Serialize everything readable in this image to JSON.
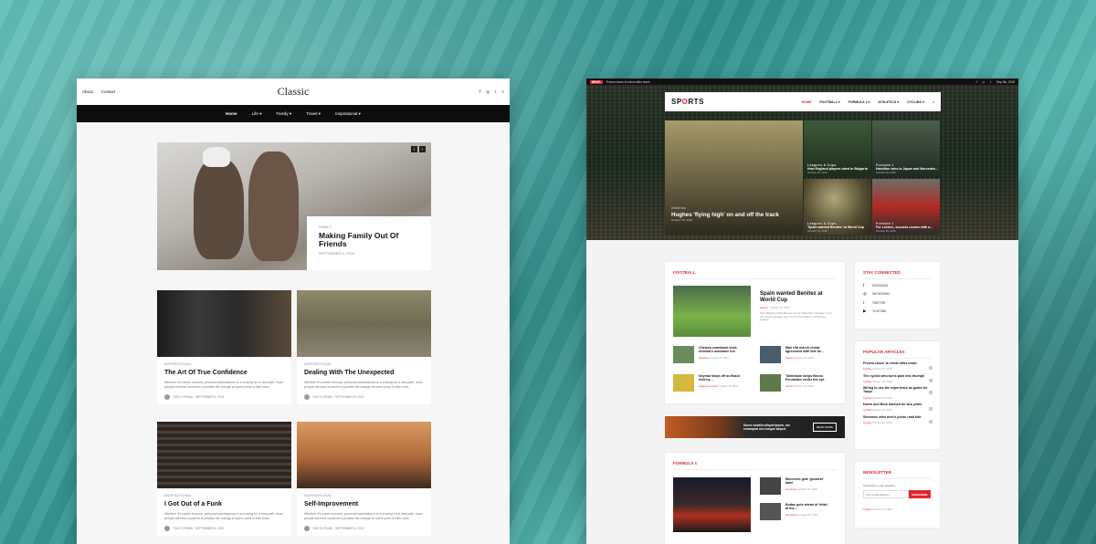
{
  "classic": {
    "top_links": [
      "About",
      "Contact"
    ],
    "logo": "Classic",
    "social": [
      "f",
      "◎",
      "t",
      "⌕"
    ],
    "nav": [
      {
        "label": "Home",
        "active": true
      },
      {
        "label": "Life ▾"
      },
      {
        "label": "Family ▾"
      },
      {
        "label": "Travel ▾"
      },
      {
        "label": "Inspirational ▾"
      }
    ],
    "hero": {
      "category": "FAMILY",
      "title": "Making Family Out Of Friends",
      "date": "SEPTEMBER 8, 2019",
      "prev": "‹",
      "next": "›"
    },
    "posts": [
      {
        "category": "INSPIRATIONAL",
        "title": "The Art Of True Confidence",
        "excerpt": "Whether it's career burnout, personal submissions or a craving for a new path, most people will hear would be a positive life change at some point in their lives.",
        "author": "TOM COPMAN",
        "date": "SEPTEMBER 8, 2019"
      },
      {
        "category": "INSPIRATIONAL",
        "title": "Dealing With The Unexpected",
        "excerpt": "Whether it's career burnout, personal submissions or a craving for a new path, most people will hear would be a positive life change at some point in their lives.",
        "author": "TOM COPMAN",
        "date": "SEPTEMBER 8, 2019"
      },
      {
        "category": "INSPIRATIONAL",
        "title": "I Got Out of a Funk",
        "excerpt": "Whether it's career burnout, personal submissions or a craving for a new path, most people will hear would be a positive life change at some point in their lives.",
        "author": "TOM COPMAN",
        "date": "SEPTEMBER 8, 2019"
      },
      {
        "category": "INSPIRATIONAL",
        "title": "Self-Improvement",
        "excerpt": "Whether it's career burnout, personal submissions or a craving for a new path, most people will hear would be a positive life change at some point in their lives.",
        "author": "TOM COPMAN",
        "date": "SEPTEMBER 8, 2019"
      }
    ]
  },
  "sports": {
    "topbar": {
      "tag": "NEWS",
      "text": "Fresno closer to return after crash",
      "date": "Sep 4th, 2019"
    },
    "logo_a": "SP",
    "logo_b": "O",
    "logo_c": "RTS",
    "menu": [
      {
        "label": "HOME",
        "active": true
      },
      {
        "label": "FOOTBALL ▾"
      },
      {
        "label": "FORMULA 1 ▾"
      },
      {
        "label": "ATHLETICS ▾"
      },
      {
        "label": "CYCLING ▾"
      }
    ],
    "feature": {
      "category": "Athletics",
      "title": "Hughes 'flying high' on and off the track",
      "date": "October 15, 2019"
    },
    "tiles": [
      {
        "category": "Leagues & Cups",
        "title": "How England players rated in Bulgaria",
        "date": "October 15, 2019"
      },
      {
        "category": "Formula 1",
        "title": "Hamilton wins in Japan and Mercedes...",
        "date": "October 15, 2019"
      },
      {
        "category": "Leagues & Cups",
        "title": "'Spain wanted Benitez' at World Cup",
        "date": "October 15, 2019"
      },
      {
        "category": "Formula 1",
        "title": "For Leclerc, success comes with a...",
        "date": "October 15, 2019"
      }
    ],
    "football": {
      "heading": "FOOTBALL",
      "lead_title": "Spain wanted Benitez at World Cup",
      "lead_cat": "Soccer",
      "lead_date": "October 15, 2019",
      "lead_excerpt": "West Bhavra is Rafa Benitez can be Tottenham manager in 2 in the current manager only into his first finalist in 22 Premier League.",
      "items": [
        {
          "title": "Chelsea comeback ends Arsenal's unbeaten run",
          "cat": "Athletics",
          "date": "October 15, 2019"
        },
        {
          "title": "Man Utd march verbal agreement with title de...",
          "cat": "Soccer",
          "date": "October 15, 2019"
        },
        {
          "title": "Neymar limps off as Brazil held by ...",
          "cat": "Leagues & Cups",
          "date": "October 15, 2019"
        },
        {
          "title": "Tottenham keeps Bruno Fernandes under the eye",
          "cat": "Soccer",
          "date": "October 15, 2019"
        }
      ]
    },
    "banner": {
      "text": "Donec sodales aliquet ipsum, nec consequat orci congue aliquet.",
      "button": "READ MORE"
    },
    "formula": {
      "heading": "FORMULA 1",
      "items": [
        {
          "title": "Mercedes gets 'greatest' label",
          "cat": "Formula 1",
          "date": "October 15, 2019"
        },
        {
          "title": "Bottas gets ahead of Vettel at the...",
          "cat": "Formula 1",
          "date": "October 15, 2019"
        }
      ]
    },
    "stay": {
      "heading": "STAY CONNECTED",
      "items": [
        {
          "icon": "f",
          "label": "FACEBOOK"
        },
        {
          "icon": "◎",
          "label": "INSTAGRAM"
        },
        {
          "icon": "t",
          "label": "TWITTER"
        },
        {
          "icon": "▶",
          "label": "YOUTUBE"
        }
      ]
    },
    "popular": {
      "heading": "POPULAR ARTICLES",
      "items": [
        {
          "title": "Fresno closer to return after crash",
          "cat": "Cycling",
          "date": "October 15, 2019"
        },
        {
          "title": "The cyclist who turns pain into triumph",
          "cat": "Cycling",
          "date": "October 15, 2019"
        },
        {
          "title": "Wiring to use the experience as guide for Tokyo",
          "cat": "Cycling",
          "date": "October 15, 2019"
        },
        {
          "title": "Karen and Beck banned for two years",
          "cat": "Cycling",
          "date": "October 15, 2019"
        },
        {
          "title": "Simmons wins men's junior road title",
          "cat": "Cycling",
          "date": "October 15, 2019"
        }
      ]
    },
    "newsletter": {
      "heading": "NEWSLETTER",
      "caption": "Subscribe to stay updated.",
      "placeholder": "Your email address",
      "button": "SUBSCRIBE",
      "cat": "Cycling",
      "date": "October 15, 2019"
    }
  }
}
